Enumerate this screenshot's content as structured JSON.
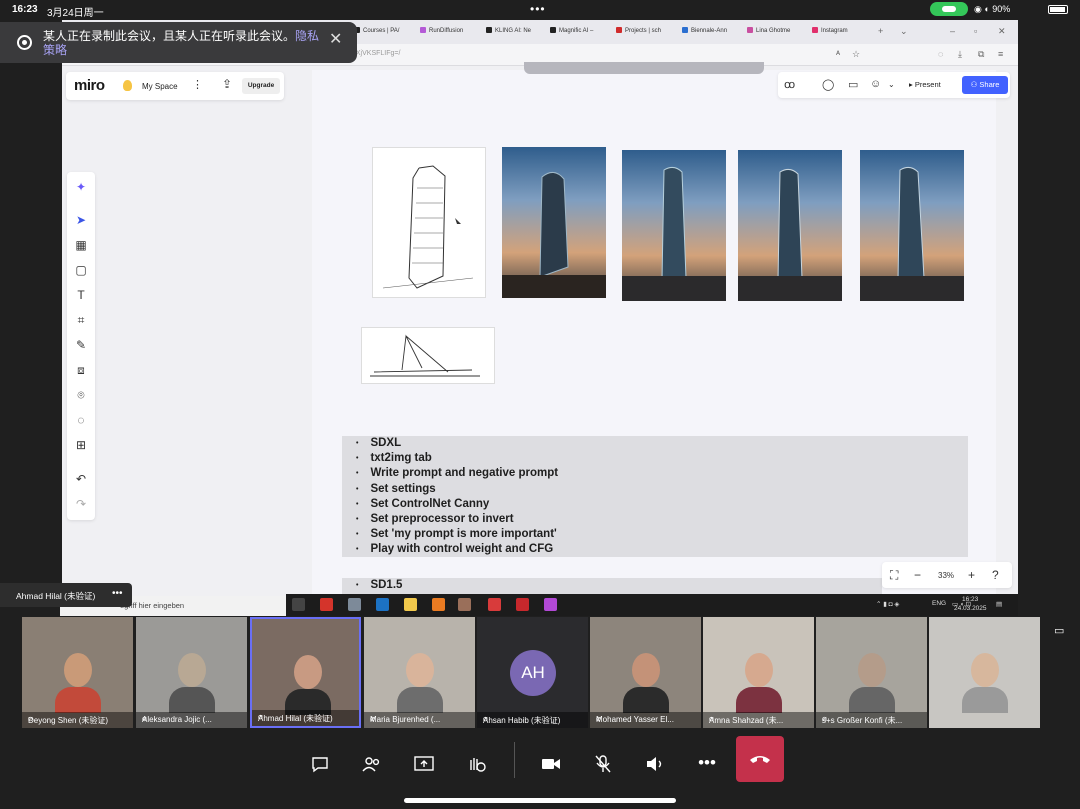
{
  "status_bar": {
    "time": "16:23",
    "date": "3月24日周一",
    "battery": "90%"
  },
  "browser": {
    "tabs": [
      {
        "label": "Courses | PA/",
        "color": "#222"
      },
      {
        "label": "RunDiffusion",
        "color": "#b45ad6"
      },
      {
        "label": "KLING AI: Ne",
        "color": "#222"
      },
      {
        "label": "Magnific AI –",
        "color": "#222"
      },
      {
        "label": "Projects | sch",
        "color": "#d02b2b"
      },
      {
        "label": "Biennale-Ann",
        "color": "#2b6fd0"
      },
      {
        "label": "Lina Ghotme",
        "color": "#c94fa0"
      },
      {
        "label": "Instagram",
        "color": "#e1306c"
      }
    ],
    "url": "uXjVKSFLIFg=/"
  },
  "miro": {
    "logo": "miro",
    "space": "My Space",
    "upgrade": "Upgrade",
    "present": "Present",
    "share": "Share",
    "zoom": "33%",
    "notes": [
      "SDXL",
      "txt2img tab",
      "Write prompt and negative prompt",
      "Set settings",
      "Set ControlNet Canny",
      "Set preprocessor to invert",
      "Set 'my prompt is more important'",
      "Play with control weight and CFG"
    ],
    "notes2": "SD1.5"
  },
  "windows": {
    "search_placeholder": "egriff hier eingeben",
    "tray_lang": "ENG",
    "tray_time": "16:23",
    "tray_date": "24.03.2025"
  },
  "banner": {
    "text": "某人正在录制此会议，且某人正在听录此会议。",
    "link": "隐私策略"
  },
  "speaker_tag": "Ahmad Hilal (未验证)",
  "participants": [
    {
      "name": "Deyong Shen (未验证)",
      "bg": "#8a7f74",
      "skin": "#c99a78",
      "shirt": "#c24a3a"
    },
    {
      "name": "Aleksandra Jojic (...",
      "bg": "#9b9a97",
      "skin": "#b8a894",
      "shirt": "#555"
    },
    {
      "name": "Ahmad Hilal (未验证)",
      "bg": "#7b6b62",
      "skin": "#c89a82",
      "shirt": "#2a2a2a"
    },
    {
      "name": "Maria Bjurenhed (...",
      "bg": "#b8b3ab",
      "skin": "#d9b49b",
      "shirt": "#6d6d6d"
    },
    {
      "name": "Ahsan Habib (未验证)",
      "initials": "AH"
    },
    {
      "name": "Mohamed Yasser El...",
      "bg": "#8d857c",
      "skin": "#c49278",
      "shirt": "#2b2b2b"
    },
    {
      "name": "Amna Shahzad (未...",
      "bg": "#c9c3ba",
      "skin": "#d6a98f",
      "shirt": "#7c3240"
    },
    {
      "name": "s+s Großer Konfi (未...",
      "bg": "#a7a49d",
      "skin": "#b49c8a",
      "shirt": "#666"
    },
    {
      "name": "",
      "bg": "#c8c6c2",
      "skin": "#d7b79d",
      "shirt": "#9a9a9a"
    }
  ],
  "colors": {
    "accent": "#4262ff",
    "hangup": "#c4314b",
    "active_border": "#6a6ff5"
  }
}
